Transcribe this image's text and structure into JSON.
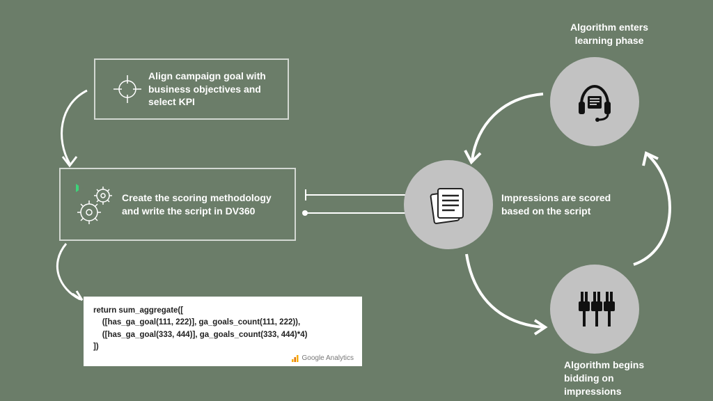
{
  "box1": {
    "text": "Align campaign goal with business objectives and select KPI"
  },
  "box2": {
    "text": "Create the scoring methodology and write the script in DV360"
  },
  "code": {
    "line1": "return sum_aggregate([",
    "line2": "    ([has_ga_goal(111, 222)], ga_goals_count(111, 222)),",
    "line3": "    ([has_ga_goal(333, 444)], ga_goals_count(333, 444)*4)",
    "line4": "])",
    "ga_label": "Google Analytics"
  },
  "labels": {
    "learning": "Algorithm enters learning phase",
    "impressions": "Impressions are scored based on the script",
    "bidding": "Algorithm begins bidding on impressions"
  }
}
